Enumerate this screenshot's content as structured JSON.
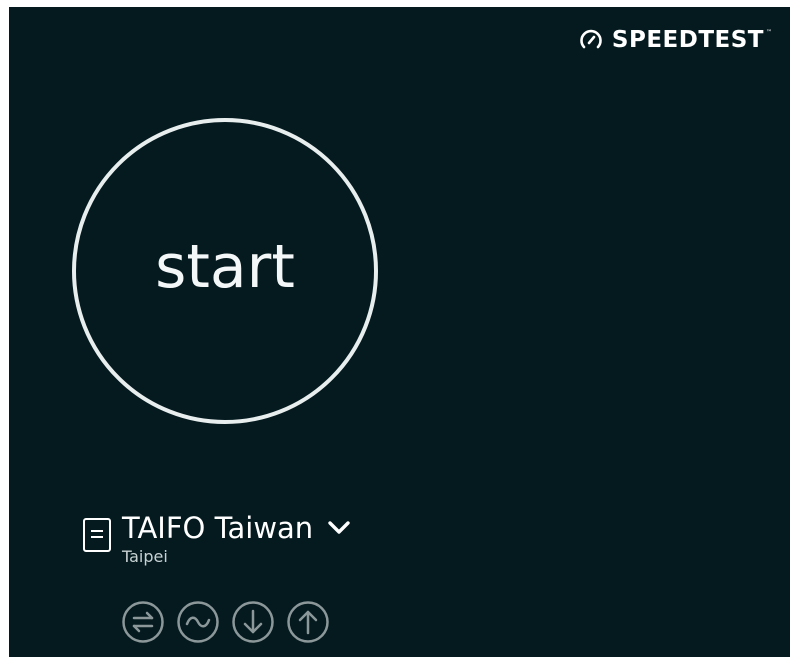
{
  "header": {
    "logo_text": "SPEEDTEST",
    "logo_tm": "™",
    "logo_icon": "gauge-icon"
  },
  "main": {
    "start_label": "start"
  },
  "server": {
    "name": "TAIFO Taiwan",
    "city": "Taipei",
    "icon": "server-icon",
    "expand_icon": "chevron-down-icon"
  },
  "metrics": [
    {
      "name": "ping-icon"
    },
    {
      "name": "jitter-icon"
    },
    {
      "name": "download-icon"
    },
    {
      "name": "upload-icon"
    }
  ],
  "colors": {
    "background": "#041a1f",
    "foreground": "#ffffff",
    "ring": "#e8eeee",
    "muted_icon": "#8b9799"
  }
}
